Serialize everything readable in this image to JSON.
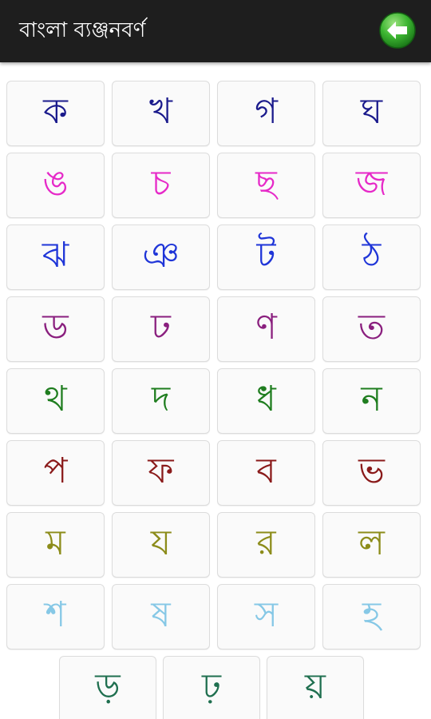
{
  "header": {
    "title": "বাংলা ব্যঞ্জনবর্ণ",
    "back_icon": "back-arrow-icon",
    "back_color": "#2fa52a"
  },
  "letters": [
    {
      "char": "ক",
      "color": "#1a1a8c"
    },
    {
      "char": "খ",
      "color": "#1a1a8c"
    },
    {
      "char": "গ",
      "color": "#1a1a8c"
    },
    {
      "char": "ঘ",
      "color": "#1a1a8c"
    },
    {
      "char": "ঙ",
      "color": "#e629c8"
    },
    {
      "char": "চ",
      "color": "#e629c8"
    },
    {
      "char": "ছ",
      "color": "#e629c8"
    },
    {
      "char": "জ",
      "color": "#e629c8"
    },
    {
      "char": "ঝ",
      "color": "#1f35d8"
    },
    {
      "char": "ঞ",
      "color": "#1f35d8"
    },
    {
      "char": "ট",
      "color": "#1f35d8"
    },
    {
      "char": "ঠ",
      "color": "#1f35d8"
    },
    {
      "char": "ড",
      "color": "#8a1f7e"
    },
    {
      "char": "ঢ",
      "color": "#8a1f7e"
    },
    {
      "char": "ণ",
      "color": "#8a1f7e"
    },
    {
      "char": "ত",
      "color": "#8a1f7e"
    },
    {
      "char": "থ",
      "color": "#1f7d1f"
    },
    {
      "char": "দ",
      "color": "#1f7d1f"
    },
    {
      "char": "ধ",
      "color": "#1f7d1f"
    },
    {
      "char": "ন",
      "color": "#1f7d1f"
    },
    {
      "char": "প",
      "color": "#8a1a1a"
    },
    {
      "char": "ফ",
      "color": "#8a1a1a"
    },
    {
      "char": "ব",
      "color": "#8a1a1a"
    },
    {
      "char": "ভ",
      "color": "#8a1a1a"
    },
    {
      "char": "ম",
      "color": "#8c8c1a"
    },
    {
      "char": "য",
      "color": "#8c8c1a"
    },
    {
      "char": "র",
      "color": "#8c8c1a"
    },
    {
      "char": "ল",
      "color": "#8c8c1a"
    },
    {
      "char": "শ",
      "color": "#86c8e6"
    },
    {
      "char": "ষ",
      "color": "#86c8e6"
    },
    {
      "char": "স",
      "color": "#86c8e6"
    },
    {
      "char": "হ",
      "color": "#86c8e6"
    }
  ],
  "last_row": [
    {
      "char": "ড়",
      "color": "#1f6f4f"
    },
    {
      "char": "ঢ়",
      "color": "#1f6f4f"
    },
    {
      "char": "য়",
      "color": "#1f6f4f"
    }
  ]
}
